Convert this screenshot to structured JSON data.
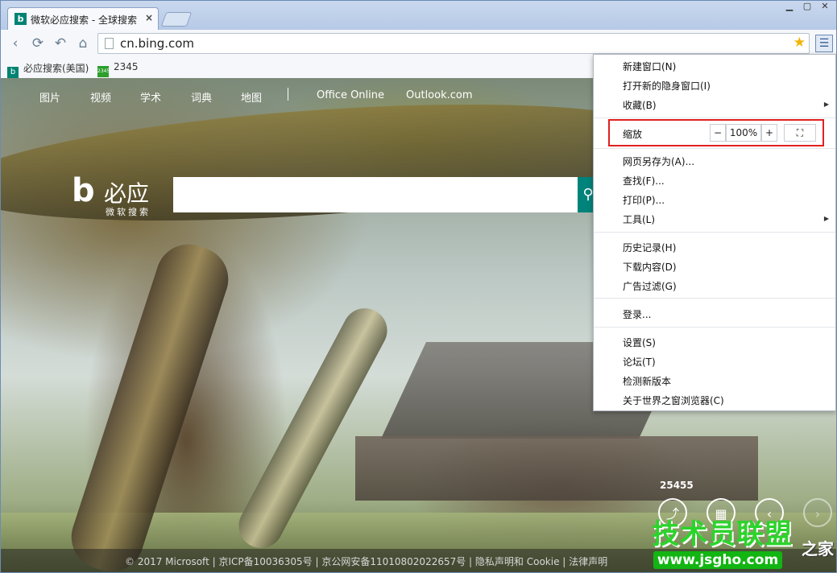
{
  "tab": {
    "title": "微软必应搜索 - 全球搜索",
    "favicon": "b",
    "close": "×"
  },
  "window_controls": {
    "minimize": "▁",
    "restore": "▢",
    "close": "✕"
  },
  "toolbar": {
    "back": "‹",
    "reload": "⟳",
    "undo": "↶",
    "home": "⌂",
    "url": "cn.bing.com",
    "star": "★",
    "menu": "☰"
  },
  "bookmarks": [
    {
      "label": "必应搜索(美国)",
      "icon": "b"
    },
    {
      "label": "2345",
      "icon": "2345"
    }
  ],
  "bing": {
    "nav": [
      "图片",
      "视频",
      "学术",
      "词典",
      "地图",
      "Office Online",
      "Outlook.com"
    ],
    "logo_char": "b",
    "logo_name": "必应",
    "logo_sub": "微软搜索",
    "search_placeholder": "",
    "search_icon": "⚲",
    "image_count": "25455",
    "circle_buttons": [
      "⤴",
      "▦",
      "‹",
      "›"
    ],
    "footer": "© 2017 Microsoft   |   京ICP备10036305号   |   京公网安备11010802022657号   |   隐私声明和 Cookie   |   法律声明"
  },
  "watermark": {
    "main": "技术员联盟",
    "url": "www.jsgho.com",
    "side": "之家"
  },
  "menu": {
    "new_window": "新建窗口(N)",
    "incognito": "打开新的隐身窗口(I)",
    "favorites": "收藏(B)",
    "zoom_label": "缩放",
    "zoom_minus": "−",
    "zoom_value": "100%",
    "zoom_plus": "+",
    "fullscreen": "⛶",
    "save_as": "网页另存为(A)...",
    "find": "查找(F)...",
    "print": "打印(P)...",
    "tools": "工具(L)",
    "history": "历史记录(H)",
    "downloads": "下载内容(D)",
    "adblock": "广告过滤(G)",
    "login": "登录...",
    "settings": "设置(S)",
    "forum": "论坛(T)",
    "check_update": "检测新版本",
    "about": "关于世界之窗浏览器(C)",
    "submenu_arrow": "▶"
  }
}
